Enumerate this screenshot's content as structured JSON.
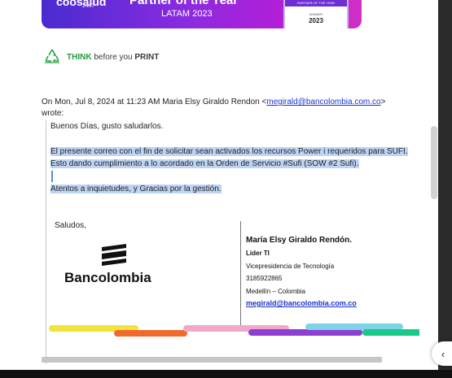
{
  "banner": {
    "logo_text": "coosalud",
    "logo_sub": "24x7",
    "headline": "Partner of the Year",
    "region": "LATAM 2023",
    "badge_top": "PARTNER OF THE YEAR",
    "badge_winner": "WINNER",
    "badge_year": "2023"
  },
  "think": {
    "think_word": "THINK",
    "middle": " before you ",
    "print_word": "PRINT"
  },
  "intro": {
    "prefix": "On Mon, Jul 8, 2024 at 11:23 AM Maria Elsy Giraldo Rendon <",
    "email": "megirald@bancolombia.com.co",
    "suffix": ">",
    "wrote": "wrote:"
  },
  "body": {
    "greeting": "Buenos Días, gusto saludarlos.",
    "para1": "El presente correo con el fin de solicitar sean activados los recursos Power i requeridos para SUFI.  Esto dando cumplimiento a lo acordado en la Orden de Servicio #Sufi (SOW #2 Sufi).",
    "para2": "Atentos a inquietudes,  y Gracias por la gestión.",
    "saludos": "Saludos,"
  },
  "signature": {
    "bank_name": "Bancolombia",
    "name": "María Elsy Giraldo Rendón.",
    "role": "Lider TI",
    "department": "Vicepresidencia de Tecnología",
    "phone": "3185922865",
    "city": "Medellín – Colombia",
    "email": "megirald@bancolombia.com.co"
  },
  "colors": {
    "link": "#1a34c9",
    "highlight": "#bdd4f5",
    "think_green": "#1e9a3e"
  },
  "icons": {
    "recycle": "recycle-icon",
    "collapse": "chevron-left-icon"
  },
  "toggle_glyph": "‹"
}
